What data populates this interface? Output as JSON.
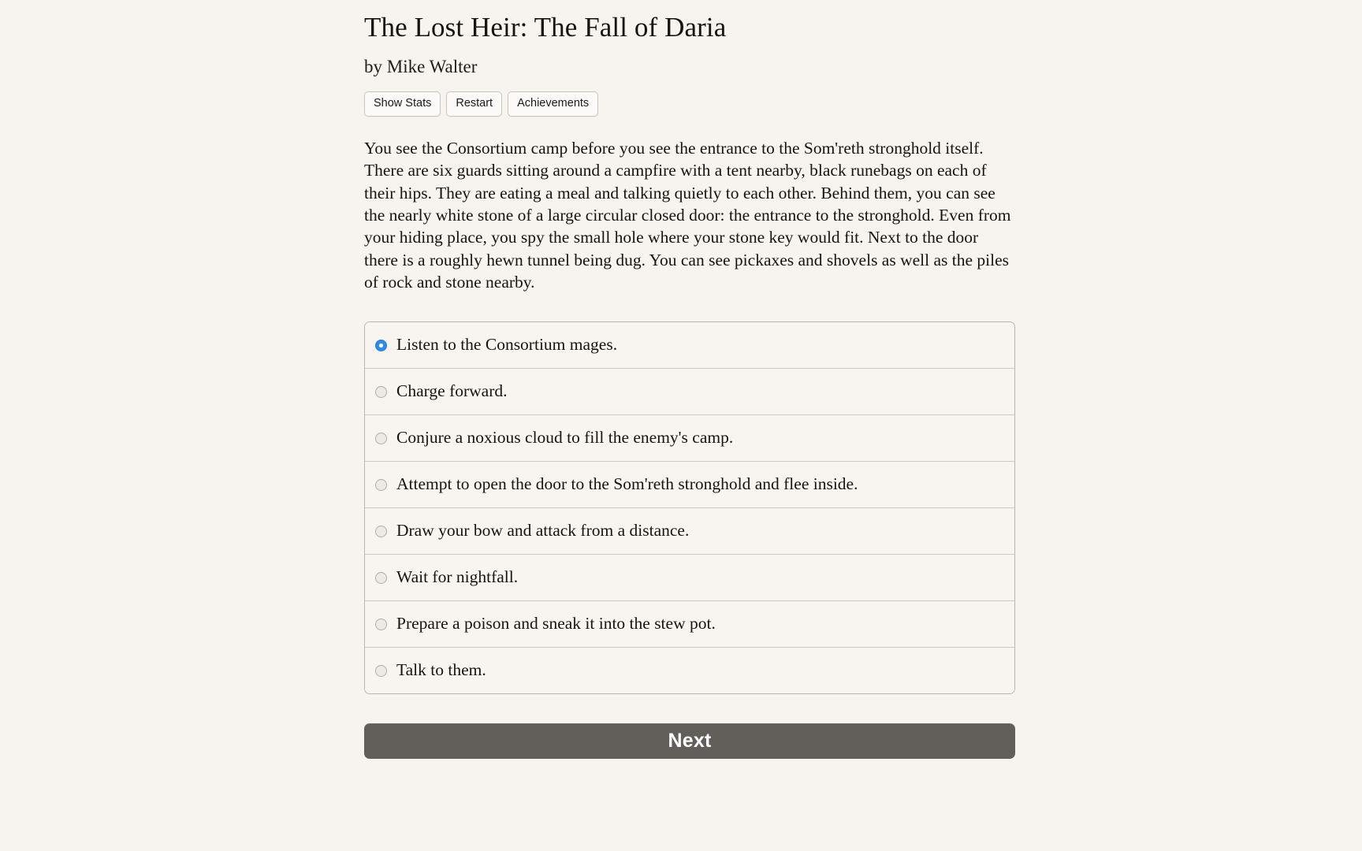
{
  "page": {
    "background_color": "#f7f4ef",
    "text_color": "#17140f"
  },
  "header": {
    "title": "The Lost Heir: The Fall of Daria",
    "byline": "by Mike Walter",
    "menu_buttons": [
      {
        "label": "Show Stats",
        "name": "show-stats-button"
      },
      {
        "label": "Restart",
        "name": "restart-button"
      },
      {
        "label": "Achievements",
        "name": "achievements-button"
      }
    ]
  },
  "story": {
    "paragraph": "You see the Consortium camp before you see the entrance to the Som'reth stronghold itself. There are six guards sitting around a campfire with a tent nearby, black runebags on each of their hips. They are eating a meal and talking quietly to each other. Behind them, you can see the nearly white stone of a large circular closed door: the entrance to the stronghold. Even from your hiding place, you spy the small hole where your stone key would fit. Next to the door there is a roughly hewn tunnel being dug. You can see pickaxes and shovels as well as the piles of rock and stone nearby."
  },
  "choices": {
    "selected_index": 0,
    "selected_color": "#2c8ced",
    "options": [
      {
        "label": "Listen to the Consortium mages.",
        "selected": true
      },
      {
        "label": "Charge forward.",
        "selected": false
      },
      {
        "label": "Conjure a noxious cloud to fill the enemy's camp.",
        "selected": false
      },
      {
        "label": "Attempt to open the door to the Som'reth stronghold and flee inside.",
        "selected": false
      },
      {
        "label": "Draw your bow and attack from a distance.",
        "selected": false
      },
      {
        "label": "Wait for nightfall.",
        "selected": false
      },
      {
        "label": "Prepare a poison and sneak it into the stew pot.",
        "selected": false
      },
      {
        "label": "Talk to them.",
        "selected": false
      }
    ]
  },
  "footer": {
    "next_label": "Next",
    "next_color": "#625e5a"
  }
}
